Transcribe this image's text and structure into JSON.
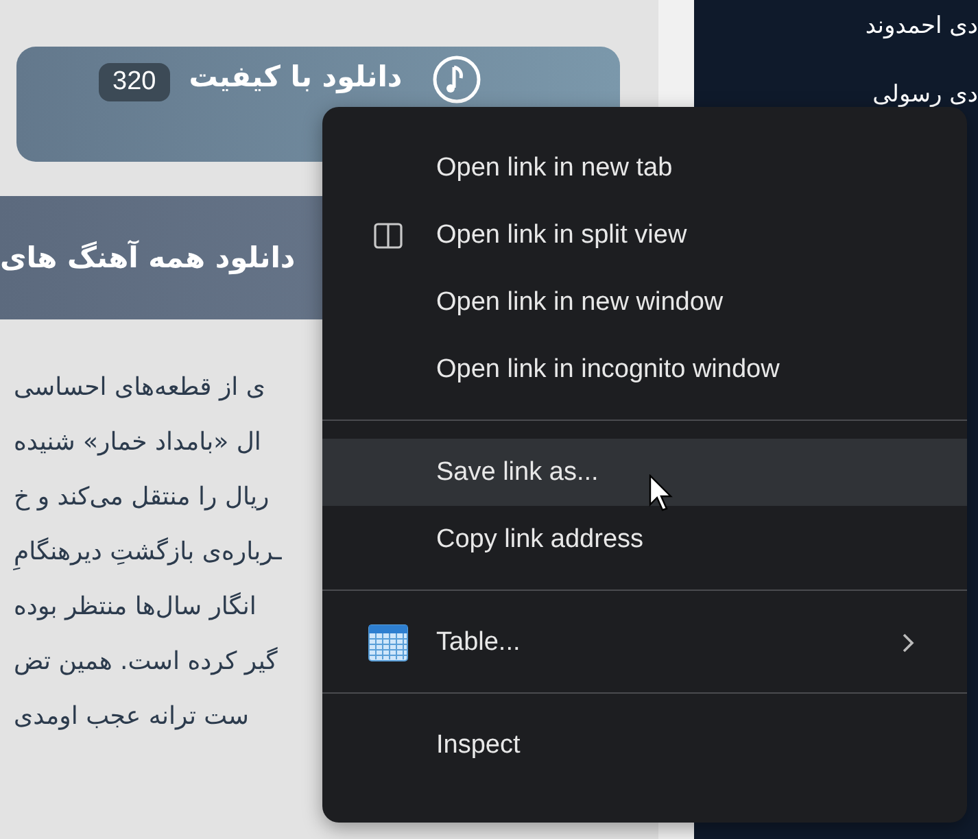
{
  "download_button": {
    "label": "دانلود با کیفیت",
    "badge": "320"
  },
  "heading": "دانلود همه آهنگ های",
  "paragraph_lines": [
    "ی از قطعه‌های احساسی",
    "ال «بامداد خمار» شنیده",
    "ریال را منتقل می‌کند و خ",
    "ـرباره‌ی بازگشتِ دیرهنگامِ",
    "انگار سال‌ها منتظر بوده",
    "گیر کرده است. همین تض",
    "ست ترانه عجب اومدی"
  ],
  "sidebar": {
    "items": [
      "دی احمدوند",
      "دی رسولی"
    ]
  },
  "context_menu": {
    "items": [
      {
        "kind": "plain",
        "label": "Open link in new tab",
        "selected": false
      },
      {
        "kind": "split",
        "label": "Open link in split view",
        "selected": false
      },
      {
        "kind": "plain",
        "label": "Open link in new window",
        "selected": false
      },
      {
        "kind": "plain",
        "label": "Open link in incognito window",
        "selected": false
      },
      {
        "kind": "separator"
      },
      {
        "kind": "plain",
        "label": "Save link as...",
        "selected": true
      },
      {
        "kind": "plain",
        "label": "Copy link address",
        "selected": false
      },
      {
        "kind": "separator"
      },
      {
        "kind": "submenu",
        "label": "Table...",
        "selected": false
      },
      {
        "kind": "separator"
      },
      {
        "kind": "plain",
        "label": "Inspect",
        "selected": false
      }
    ]
  }
}
